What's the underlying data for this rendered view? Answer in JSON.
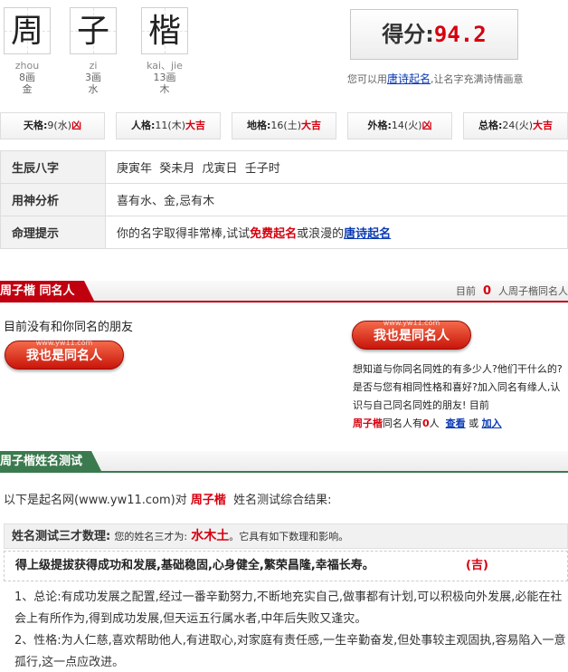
{
  "chars": [
    {
      "char": "周",
      "pinyin": "zhou",
      "strokes": "8画",
      "element": "金"
    },
    {
      "char": "子",
      "pinyin": "zi",
      "strokes": "3画",
      "element": "水"
    },
    {
      "char": "楷",
      "pinyin": "kai、jie",
      "strokes": "13画",
      "element": "木"
    }
  ],
  "score": {
    "label": "得分:",
    "value": "94.2"
  },
  "score_tip": {
    "pre": "您可以用",
    "link": "唐诗起名",
    "post": ",让名字充满诗情画意"
  },
  "ge": [
    {
      "label": "天格:",
      "value": "9(水)",
      "result": "凶"
    },
    {
      "label": "人格:",
      "value": "11(木)",
      "result": "大吉"
    },
    {
      "label": "地格:",
      "value": "16(土)",
      "result": "大吉"
    },
    {
      "label": "外格:",
      "value": "14(火)",
      "result": "凶"
    },
    {
      "label": "总格:",
      "value": "24(火)",
      "result": "大吉"
    }
  ],
  "info": {
    "bazi_label": "生辰八字",
    "bazi_value": "庚寅年  癸未月  戊寅日  壬子时",
    "yongshen_label": "用神分析",
    "yongshen_value": "喜有水、金,忌有木",
    "tip_label": "命理提示",
    "tip_pre": "你的名字取得非常棒,试试",
    "tip_free": "免费起名",
    "tip_mid": "或浪漫的",
    "tip_link": "唐诗起名"
  },
  "same_name": {
    "title": "周子楷 同名人",
    "right_pre": "目前",
    "right_num": "0",
    "right_post": "人周子楷同名人",
    "none_text": "目前没有和你同名的朋友",
    "btn_label": "我也是同名人",
    "btn_small": "www.yw11.com",
    "side_text": "想知道与你同名同姓的有多少人?他们干什么的?是否与您有相同性格和喜好?加入同名有缘人,认识与自己同名同姓的朋友! 目前",
    "side_name": "周子楷",
    "side_count_pre": "同名人有",
    "side_count": "0",
    "side_count_post": "人",
    "view_link": "查看",
    "or": "或",
    "join_link": "加入"
  },
  "test": {
    "title": "周子楷姓名测试",
    "result_pre": "以下是起名网(www.yw11.com)对",
    "result_name": "周子楷",
    "result_post": "姓名测试综合结果:",
    "sancai_label": "姓名测试三才数理:",
    "sancai_small": "您的姓名三才为:",
    "sancai_value": "水木土",
    "sancai_post": "。它具有如下数理和影响。",
    "verdict": "得上级提拔获得成功和发展,基础稳固,心身健全,繁荣昌隆,幸福长寿。",
    "verdict_ji": "(吉)",
    "detail1": "1、总论:有成功发展之配置,经过一番辛勤努力,不断地充实自己,做事都有计划,可以积极向外发展,必能在社会上有所作为,得到成功发展,但天运五行属水者,中年后失败又逢灾。",
    "detail2": "2、性格:为人仁慈,喜欢帮助他人,有进取心,对家庭有责任感,一生辛勤奋发,但处事较主观固执,容易陷入一意孤行,这一点应改进。"
  }
}
